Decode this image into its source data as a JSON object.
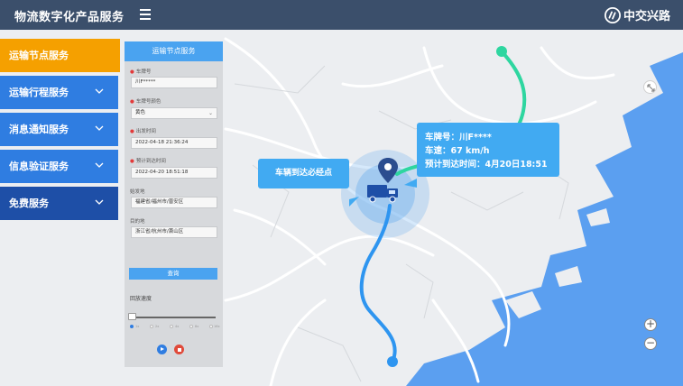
{
  "header": {
    "title": "物流数字化产品服务",
    "brand": "中交兴路",
    "menu_icon": "hamburger-icon",
    "brand_icon": "brand-logo-icon"
  },
  "colors": {
    "header_bg": "#3b4f6b",
    "accent_blue": "#2f7de1",
    "active_orange": "#f5a000",
    "sea_blue": "#5b9ff0",
    "route_blue": "#2e95f0",
    "route_green": "#2ed6a0"
  },
  "sidebar": {
    "items": [
      {
        "label": "运输节点服务",
        "active": true,
        "icon": ""
      },
      {
        "label": "运输行程服务",
        "active": false,
        "icon": "chevron-down-icon"
      },
      {
        "label": "消息通知服务",
        "active": false,
        "icon": "chevron-down-icon"
      },
      {
        "label": "信息验证服务",
        "active": false,
        "icon": "chevron-down-icon"
      },
      {
        "label": "免费服务",
        "active": false,
        "icon": "chevron-down-icon"
      }
    ]
  },
  "panel": {
    "title": "运输节点服务",
    "fields": [
      {
        "label": "车牌号",
        "required": true,
        "value": "川F*****"
      },
      {
        "label": "车牌号颜色",
        "required": true,
        "value": "黄色",
        "type": "select"
      },
      {
        "label": "出发时间",
        "required": true,
        "value": "2022-04-18 21:36:24"
      },
      {
        "label": "预计到达时间",
        "required": true,
        "value": "2022-04-20 18:51:18"
      },
      {
        "label": "始发地",
        "required": false,
        "value": "福建省/福州市/晋安区"
      },
      {
        "label": "目的地",
        "required": false,
        "value": "浙江省/杭州市/萧山区"
      }
    ],
    "query_label": "查询",
    "progress_label": "回放速度",
    "playback_speed_index": 0,
    "speed_options": [
      "1x",
      "2x",
      "4x",
      "8x",
      "16x"
    ],
    "play_icon": "play-icon",
    "stop_icon": "stop-icon"
  },
  "map": {
    "destination_callout": "车辆到达必经点",
    "info": {
      "plate": "车牌号：川F****",
      "speed": "车速：67 km/h",
      "eta": "预计到达时间：4月20日18:51"
    },
    "controls": {
      "expand_icon": "expand-icon",
      "zoom_in": "+",
      "zoom_out": "−"
    },
    "markers": {
      "truck_icon": "truck-icon",
      "pin_icon": "location-pin-icon"
    }
  }
}
